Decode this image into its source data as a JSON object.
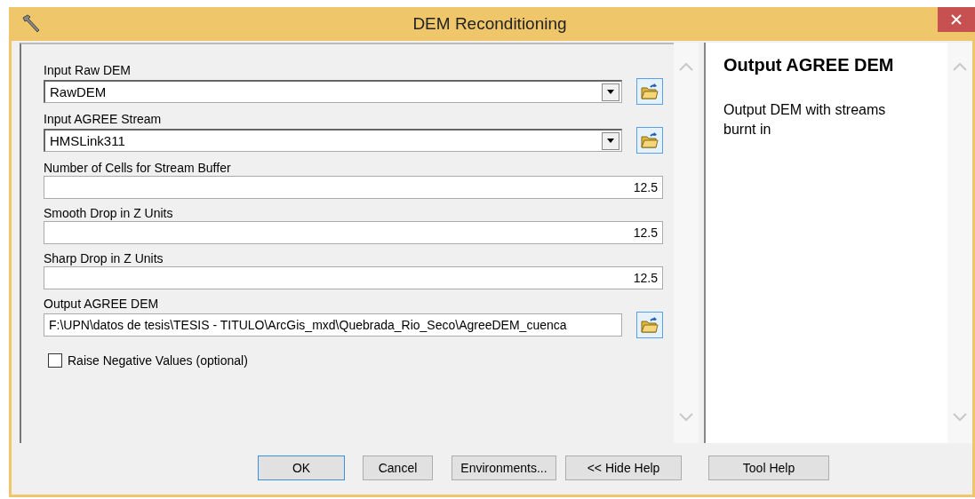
{
  "window": {
    "title": "DEM Reconditioning"
  },
  "parameters": [
    {
      "kind": "dropdown",
      "label": "Input Raw DEM",
      "value": "RawDEM"
    },
    {
      "kind": "dropdown",
      "label": "Input AGREE Stream",
      "value": "HMSLink311"
    },
    {
      "kind": "number",
      "label": "Number of Cells for Stream Buffer",
      "value": "12.5"
    },
    {
      "kind": "number",
      "label": "Smooth Drop in Z Units",
      "value": "12.5"
    },
    {
      "kind": "number",
      "label": "Sharp Drop in Z Units",
      "value": "12.5"
    },
    {
      "kind": "path",
      "label": "Output AGREE DEM",
      "value": "F:\\UPN\\datos de tesis\\TESIS - TITULO\\ArcGis_mxd\\Quebrada_Rio_Seco\\AgreeDEM_cuenca"
    },
    {
      "kind": "checkbox",
      "label": "Raise Negative Values (optional)",
      "checked": false
    }
  ],
  "help": {
    "title": "Output AGREE DEM",
    "text": "Output DEM with streams burnt in"
  },
  "buttons": [
    {
      "label": "OK",
      "default": true
    },
    {
      "label": "Cancel",
      "default": false
    },
    {
      "label": "Environments...",
      "default": false
    },
    {
      "label": "<< Hide Help",
      "default": false
    },
    {
      "label": "Tool Help",
      "default": false
    }
  ]
}
